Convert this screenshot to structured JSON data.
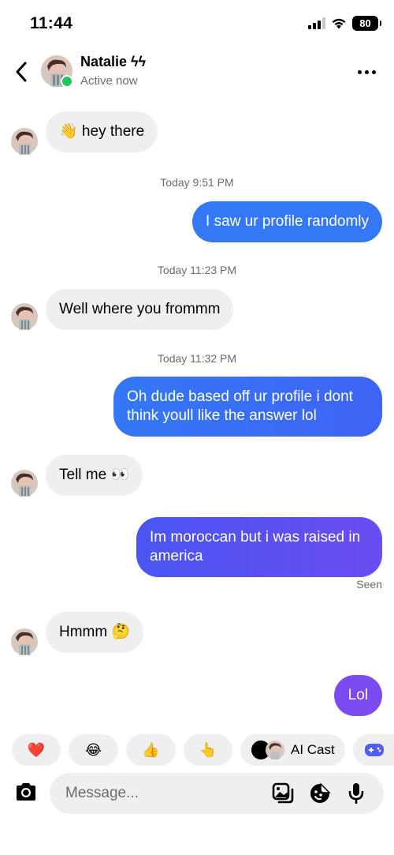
{
  "status_bar": {
    "time": "11:44",
    "battery": "80"
  },
  "header": {
    "name": "Natalie ϟϟ",
    "status": "Active now"
  },
  "messages": [
    {
      "side": "in",
      "text": "👋 hey there"
    },
    {
      "type": "timestamp",
      "text": "Today 9:51 PM"
    },
    {
      "side": "out",
      "text": "I saw ur profile randomly"
    },
    {
      "type": "timestamp",
      "text": "Today 11:23 PM"
    },
    {
      "side": "in",
      "text": "Well where you frommm"
    },
    {
      "type": "timestamp",
      "text": "Today 11:32 PM"
    },
    {
      "side": "out",
      "text": "Oh dude based off ur profile i dont think youll like the answer lol"
    },
    {
      "side": "in",
      "text": "Tell me 👀"
    },
    {
      "side": "out",
      "text": "Im moroccan but i was raised in america"
    },
    {
      "side": "in",
      "text": "Hmmm 🤔"
    },
    {
      "side": "out",
      "text": "Lol"
    }
  ],
  "seen_label": "Seen",
  "quick_replies": [
    "❤️",
    "😂",
    "👍",
    "👆"
  ],
  "ai_cast_label": "AI Cast",
  "composer": {
    "placeholder": "Message..."
  },
  "colors": {
    "accent_blue": "#3478F6",
    "accent_purple": "#7B4BF2",
    "incoming_bubble": "#EFEFEF",
    "online_green": "#22C55E"
  },
  "icons": [
    "back-arrow-icon",
    "more-icon",
    "camera-icon",
    "gallery-icon",
    "sticker-icon",
    "microphone-icon",
    "game-icon"
  ]
}
